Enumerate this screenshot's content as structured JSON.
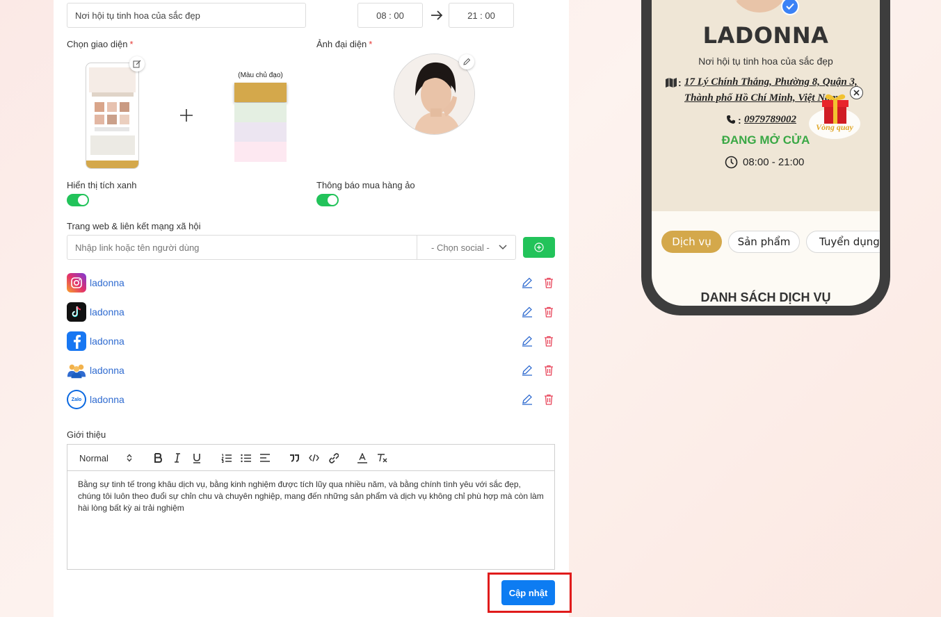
{
  "form": {
    "slogan_value": "Nơi hội tụ tinh hoa của sắc đẹp",
    "open_time": "08 : 00",
    "close_time": "21 : 00",
    "theme_label": "Chọn giao diện",
    "avatar_label": "Ảnh đại diện",
    "required_mark": "*",
    "main_color_label": "(Màu chủ đạo)",
    "main_color": "#d4a84b",
    "palette": [
      "#d4a84b",
      "#e4efe2",
      "#ece5f1",
      "#fde8f1"
    ],
    "verified_label": "Hiển thị tích xanh",
    "fake_order_label": "Thông báo mua hàng ảo",
    "social_section_label": "Trang web & liên kết mạng xã hội",
    "social_input_placeholder": "Nhập link hoặc tên người dùng",
    "social_select": "- Chọn social -",
    "social_items": [
      {
        "name": "ladonna",
        "icon": "instagram-icon"
      },
      {
        "name": "ladonna",
        "icon": "tiktok-icon"
      },
      {
        "name": "ladonna",
        "icon": "facebook-icon"
      },
      {
        "name": "ladonna",
        "icon": "group-icon"
      },
      {
        "name": "ladonna",
        "icon": "zalo-icon"
      }
    ],
    "intro_label": "Giới thiệu",
    "editor_format": "Normal",
    "intro_text": "Bằng sự tinh tế trong khâu dịch vụ, bằng kinh nghiệm được tích lũy qua nhiều năm, và bằng chính tình yêu với sắc đẹp, chúng tôi luôn theo đuổi sự chỉn chu và chuyên nghiệp, mang đến những sản phẩm và dịch vụ không chỉ phù hợp mà còn làm hài lòng bất kỳ ai trải nghiệm",
    "update_button": "Cập nhật",
    "accent_color": "#0d7cf2",
    "toggle_color": "#22c35a"
  },
  "preview": {
    "brand": "LADONNA",
    "slogan": "Nơi hội tụ tinh hoa của sắc đẹp",
    "address_line1": "17 Lý Chính Thắng, Phường 8, Quận 3,",
    "address_line2": "Thành phố Hồ Chí Minh, Việt Nam",
    "address_prefix": ":",
    "phone_prefix": ":",
    "phone": "0979789002",
    "status": "ĐANG MỞ CỬA",
    "hours": "08:00 - 21:00",
    "lucky_wheel": "Vòng quay",
    "tabs": [
      "Dịch vụ",
      "Sản phẩm",
      "Tuyển dụng"
    ],
    "section_title": "DANH SÁCH DỊCH VỤ",
    "status_color": "#3aa845",
    "gold_color": "#d4a84b"
  }
}
